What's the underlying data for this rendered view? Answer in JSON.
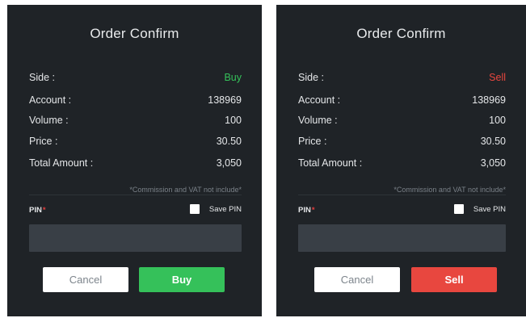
{
  "colors": {
    "dialog_bg": "#1f2327",
    "buy_green": "#35c15a",
    "sell_red": "#e8473f",
    "required_star": "#e53e3e"
  },
  "buy_dialog": {
    "title": "Order Confirm",
    "side_label": "Side :",
    "side_value": "Buy",
    "account_label": "Account :",
    "account_value": "138969",
    "volume_label": "Volume :",
    "volume_value": "100",
    "price_label": "Price :",
    "price_value": "30.50",
    "total_label": "Total Amount :",
    "total_value": "3,050",
    "note": "*Commission and VAT not include*",
    "pin_label": "PIN",
    "pin_required": "*",
    "save_pin_label": "Save PIN",
    "pin_value": "",
    "cancel_label": "Cancel",
    "confirm_label": "Buy"
  },
  "sell_dialog": {
    "title": "Order Confirm",
    "side_label": "Side :",
    "side_value": "Sell",
    "account_label": "Account :",
    "account_value": "138969",
    "volume_label": "Volume :",
    "volume_value": "100",
    "price_label": "Price :",
    "price_value": "30.50",
    "total_label": "Total Amount :",
    "total_value": "3,050",
    "note": "*Commission and VAT not include*",
    "pin_label": "PIN",
    "pin_required": "*",
    "save_pin_label": "Save PIN",
    "pin_value": "",
    "cancel_label": "Cancel",
    "confirm_label": "Sell"
  }
}
